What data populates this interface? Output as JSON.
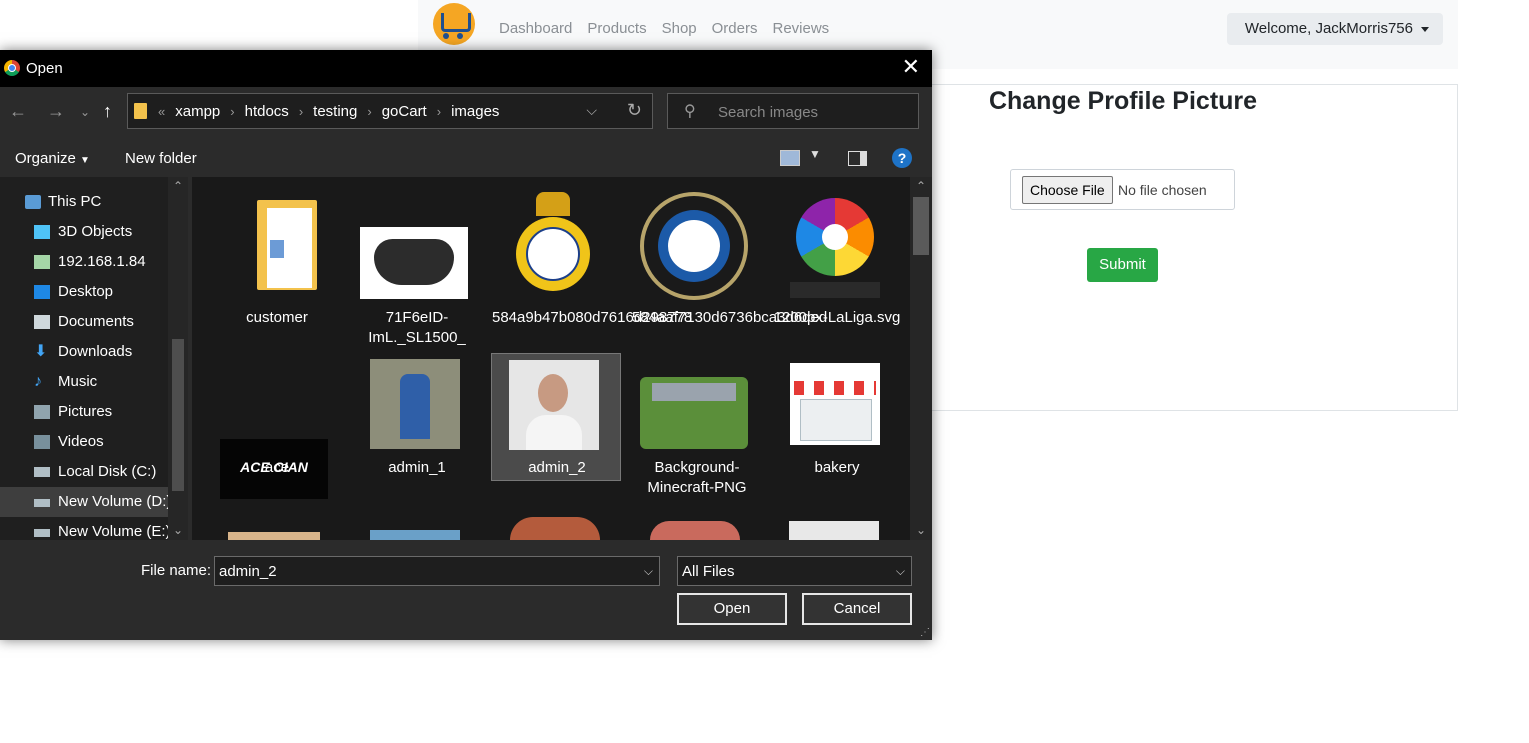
{
  "web": {
    "nav_links": [
      "Dashboard",
      "Products",
      "Shop",
      "Orders",
      "Reviews"
    ],
    "welcome": "Welcome, JackMorris756",
    "card_title": "Change Profile Picture",
    "file_button": "Choose File",
    "file_status": "No file chosen",
    "submit": "Submit"
  },
  "dialog": {
    "title": "Open",
    "close": "✕",
    "breadcrumb_more": "«",
    "breadcrumbs": [
      "xampp",
      "htdocs",
      "testing",
      "goCart",
      "images"
    ],
    "search_placeholder": "Search images",
    "organize": "Organize",
    "new_folder": "New folder",
    "help": "?",
    "sidebar": [
      {
        "label": "This PC",
        "icon": "computer-icon"
      },
      {
        "label": "3D Objects",
        "icon": "cube-icon"
      },
      {
        "label": "192.168.1.84",
        "icon": "network-drive-icon"
      },
      {
        "label": "Desktop",
        "icon": "desktop-icon"
      },
      {
        "label": "Documents",
        "icon": "documents-icon"
      },
      {
        "label": "Downloads",
        "icon": "download-icon"
      },
      {
        "label": "Music",
        "icon": "music-icon"
      },
      {
        "label": "Pictures",
        "icon": "pictures-icon"
      },
      {
        "label": "Videos",
        "icon": "videos-icon"
      },
      {
        "label": "Local Disk (C:)",
        "icon": "disk-icon"
      },
      {
        "label": "New Volume (D:)",
        "icon": "drive-icon"
      },
      {
        "label": "New Volume (E:)",
        "icon": "drive-icon"
      }
    ],
    "files": [
      {
        "name": "customer",
        "kind": "folder"
      },
      {
        "name": "71F6eID-ImL._SL1500_",
        "kind": "image"
      },
      {
        "name": "584a9b47b080d7616d298778",
        "kind": "image"
      },
      {
        "name": "584aaf7130d6736bca3d6ded",
        "kind": "image"
      },
      {
        "name": "1200px-LaLiga.svg",
        "kind": "image"
      },
      {
        "name": "ace",
        "kind": "image"
      },
      {
        "name": "admin_1",
        "kind": "image"
      },
      {
        "name": "admin_2",
        "kind": "image",
        "selected": true
      },
      {
        "name": "Background-Minecraft-PNG",
        "kind": "image"
      },
      {
        "name": "bakery",
        "kind": "image"
      }
    ],
    "file_name_label": "File name:",
    "file_name_value": "admin_2",
    "file_type": "All Files",
    "open": "Open",
    "cancel": "Cancel"
  }
}
